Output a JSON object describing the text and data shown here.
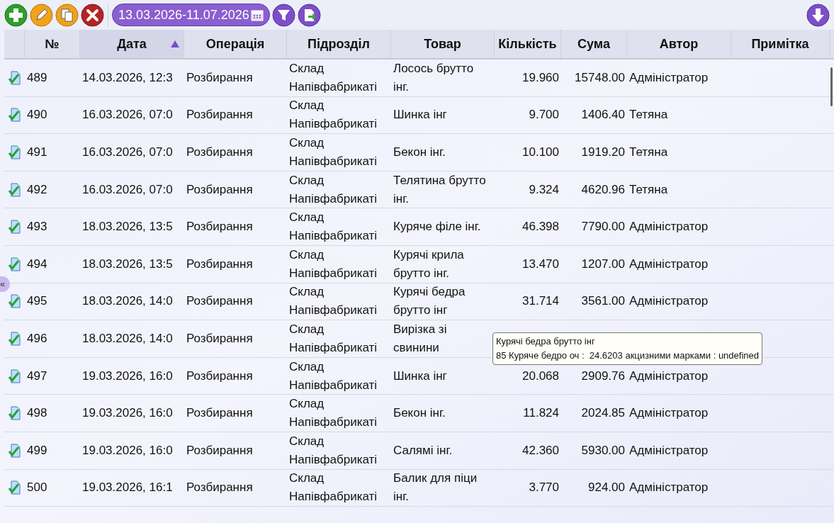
{
  "toolbar": {
    "date_range": "13.03.2026-11.07.2026"
  },
  "table": {
    "columns": [
      {
        "label": "№"
      },
      {
        "label": "Дата",
        "sorted": true
      },
      {
        "label": "Операція"
      },
      {
        "label": "Підрозділ"
      },
      {
        "label": "Товар"
      },
      {
        "label": "Кількість"
      },
      {
        "label": "Сума"
      },
      {
        "label": "Автор"
      },
      {
        "label": "Примітка"
      }
    ],
    "rows": [
      {
        "cells": [
          "489",
          "14.03.2026, 12:3",
          "Розбирання",
          "Склад Напівфабрикаті",
          "Лосось брутто інг.",
          "19.960",
          "15748.00",
          "Адміністратор"
        ]
      },
      {
        "cells": [
          "490",
          "16.03.2026, 07:0",
          "Розбирання",
          "Склад Напівфабрикаті",
          "Шинка інг",
          "9.700",
          "1406.40",
          "Тетяна"
        ]
      },
      {
        "cells": [
          "491",
          "16.03.2026, 07:0",
          "Розбирання",
          "Склад Напівфабрикаті",
          "Бекон інг.",
          "10.100",
          "1919.20",
          "Тетяна"
        ]
      },
      {
        "cells": [
          "492",
          "16.03.2026, 07:0",
          "Розбирання",
          "Склад Напівфабрикаті",
          "Телятина брутто інг.",
          "9.324",
          "4620.96",
          "Тетяна"
        ]
      },
      {
        "cells": [
          "493",
          "18.03.2026, 13:5",
          "Розбирання",
          "Склад Напівфабрикаті",
          "Куряче філе інг.",
          "46.398",
          "7790.00",
          "Адміністратор"
        ]
      },
      {
        "cells": [
          "494",
          "18.03.2026, 13:5",
          "Розбирання",
          "Склад Напівфабрикаті",
          "Курячі крила брутто інг.",
          "13.470",
          "1207.00",
          "Адміністратор"
        ]
      },
      {
        "cells": [
          "495",
          "18.03.2026, 14:0",
          "Розбирання",
          "Склад Напівфабрикаті",
          "Курячі бедра брутто інг",
          "31.714",
          "3561.00",
          "Адміністратор"
        ]
      },
      {
        "cells": [
          "496",
          "18.03.2026, 14:0",
          "Розбирання",
          "Склад Напівфабрикаті",
          "Вирізка зі свинини"
        ]
      },
      {
        "cells": [
          "497",
          "19.03.2026, 16:0",
          "Розбирання",
          "Склад Напівфабрикаті",
          "Шинка інг",
          "20.068",
          "2909.76",
          "Адміністратор"
        ]
      },
      {
        "cells": [
          "498",
          "19.03.2026, 16:0",
          "Розбирання",
          "Склад Напівфабрикаті",
          "Бекон інг.",
          "11.824",
          "2024.85",
          "Адміністратор"
        ]
      },
      {
        "cells": [
          "499",
          "19.03.2026, 16:0",
          "Розбирання",
          "Склад Напівфабрикаті",
          "Салямі інг.",
          "42.360",
          "5930.00",
          "Адміністратор"
        ]
      },
      {
        "cells": [
          "500",
          "19.03.2026, 16:1",
          "Розбирання",
          "Склад Напівфабрикаті",
          "Балик для піци інг.",
          "3.770",
          "924.00",
          "Адміністратор"
        ]
      }
    ]
  },
  "tooltip": {
    "lines": [
      "Курячі бедра брутто інг",
      "85 Куряче бедро оч :  24.6203 акцизними марками : undefined"
    ]
  },
  "side_tab": "«"
}
